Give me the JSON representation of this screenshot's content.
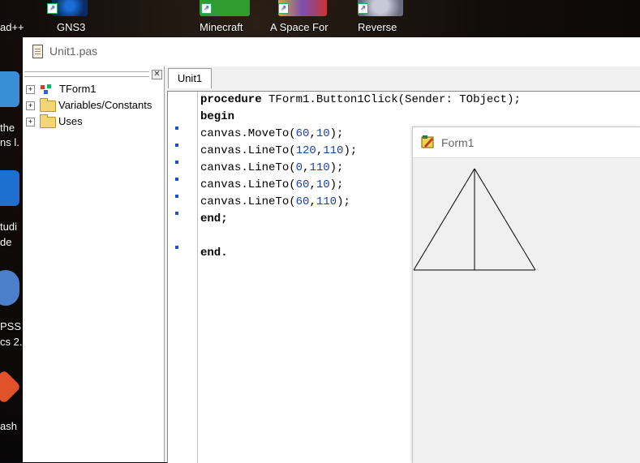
{
  "desktop": {
    "top_icons": [
      {
        "label": "ad++"
      },
      {
        "label": "GNS3"
      },
      {
        "label": "Minecraft"
      },
      {
        "label": "A Space For"
      },
      {
        "label": "Reverse"
      }
    ],
    "left_icons": [
      {
        "line1": "the",
        "line2": "ns l."
      },
      {
        "line1": "tudi",
        "line2": "de"
      },
      {
        "line1": "PSS",
        "line2": "cs 2."
      },
      {
        "line1": "ash",
        "line2": ""
      }
    ]
  },
  "ide": {
    "title": "Unit1.pas",
    "tree": {
      "nodes": [
        {
          "label": "TForm1"
        },
        {
          "label": "Variables/Constants"
        },
        {
          "label": "Uses"
        }
      ]
    },
    "tab": "Unit1",
    "code": {
      "line1_kw": "procedure",
      "line1_rest": " TForm1.Button1Click(Sender: TObject);",
      "line2": "begin",
      "line3_a": "canvas.MoveTo(",
      "line3_n1": "60",
      "line3_c": ",",
      "line3_n2": "10",
      "line3_e": ");",
      "line4_a": "canvas.LineTo(",
      "line4_n1": "120",
      "line4_c": ",",
      "line4_n2": "110",
      "line4_e": ");",
      "line5_a": "canvas.LineTo(",
      "line5_n1": "0",
      "line5_c": ",",
      "line5_n2": "110",
      "line5_e": ");",
      "line6_a": "canvas.LineTo(",
      "line6_n1": "60",
      "line6_c": ",",
      "line6_n2": "10",
      "line6_e": ");",
      "line7_a": "canvas.LineTo(",
      "line7_n1": "60",
      "line7_c": ",",
      "line7_n2": "110",
      "line7_e": ");",
      "line8": "end;",
      "line10": "end."
    }
  },
  "form1": {
    "title": "Form1"
  }
}
